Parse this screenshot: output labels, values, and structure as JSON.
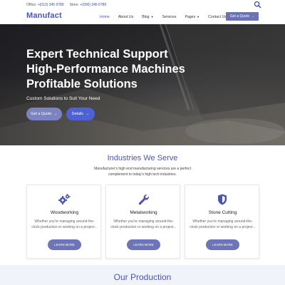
{
  "topbar": {
    "office_label": "Office:",
    "office_phone": "+(012) 345 6789",
    "store_label": "Store:",
    "store_phone": "+(000) 345 6789"
  },
  "nav": {
    "brand": "Manufact",
    "items": [
      {
        "label": "Home",
        "active": true,
        "dropdown": false
      },
      {
        "label": "About Us",
        "active": false,
        "dropdown": false
      },
      {
        "label": "Blog",
        "active": false,
        "dropdown": true
      },
      {
        "label": "Services",
        "active": false,
        "dropdown": false
      },
      {
        "label": "Pages",
        "active": false,
        "dropdown": true
      },
      {
        "label": "Contact Us",
        "active": false,
        "dropdown": false
      }
    ],
    "quote_label": "Get a Quote",
    "quote_arrow": "→"
  },
  "hero": {
    "line1": "Expert Technical Support",
    "line2": "High-Performance Machines",
    "line3": "Profitable Solutions",
    "subtitle": "Custom Solutions to Suit Your Need",
    "btn_quote": "Get a Quote",
    "btn_details": "Details",
    "arrow": "→"
  },
  "industries": {
    "title": "Industries We Serve",
    "description": "Manufacturer's high end manufacturing services are a perfect complement to today's high tech industries.",
    "cards": [
      {
        "title": "Woodworking",
        "text": "Whether you're managing around-the-clock production or working on a project...",
        "button": "LEARN MORE",
        "icon": "gears-icon"
      },
      {
        "title": "Metalworking",
        "text": "Whether you're managing around-the-clock production or working on a project...",
        "button": "LEARN MORE",
        "icon": "wrench-icon"
      },
      {
        "title": "Stone Cutting",
        "text": "Whether you're managing around-the-clock production or working on a project...",
        "button": "LEARN MORE",
        "icon": "shield-icon"
      }
    ]
  },
  "production": {
    "title": "Our Production"
  },
  "colors": {
    "accent": "#4a56b0",
    "button": "#6d75b8",
    "details_button": "#4e62d6"
  }
}
